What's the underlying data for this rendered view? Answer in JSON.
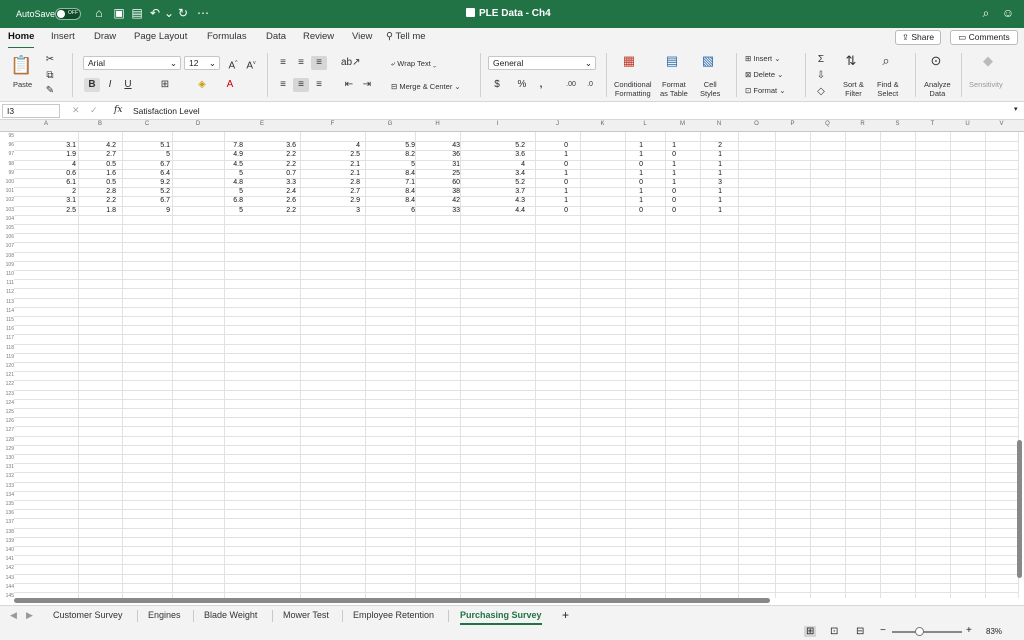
{
  "titlebar": {
    "autosave_label": "AutoSave",
    "autosave_state": "OFF",
    "doc_title": "PLE Data - Ch4"
  },
  "tabs": [
    "Home",
    "Insert",
    "Draw",
    "Page Layout",
    "Formulas",
    "Data",
    "Review",
    "View",
    "Tell me"
  ],
  "share_label": "Share",
  "comments_label": "Comments",
  "ribbon": {
    "paste": "Paste",
    "font_name": "Arial",
    "font_size": "12",
    "wrap_text": "Wrap Text",
    "merge_center": "Merge & Center",
    "number_format": "General",
    "conditional_formatting": [
      "Conditional",
      "Formatting"
    ],
    "format_as_table": [
      "Format",
      "as Table"
    ],
    "cell_styles": [
      "Cell",
      "Styles"
    ],
    "insert": "Insert",
    "delete": "Delete",
    "format": "Format",
    "sort_filter": [
      "Sort &",
      "Filter"
    ],
    "find_select": [
      "Find &",
      "Select"
    ],
    "analyze_data": [
      "Analyze",
      "Data"
    ],
    "sensitivity": "Sensitivity"
  },
  "formula_bar": {
    "name_box": "I3",
    "content": "Satisfaction Level"
  },
  "column_headers": [
    "A",
    "B",
    "C",
    "D",
    "E",
    "F",
    "G",
    "H",
    "I",
    "J",
    "K",
    "L",
    "M",
    "N",
    "O",
    "P",
    "Q",
    "R",
    "S",
    "T",
    "U",
    "V"
  ],
  "row_numbers": [
    "95",
    "96",
    "97",
    "98",
    "99",
    "100",
    "101",
    "102",
    "103",
    "104",
    "105",
    "106",
    "107",
    "108",
    "109",
    "110",
    "111",
    "112",
    "113",
    "114",
    "115",
    "116",
    "117",
    "118",
    "119",
    "120",
    "121",
    "122",
    "123",
    "124",
    "125",
    "126",
    "127",
    "128",
    "129",
    "130",
    "131",
    "132",
    "133",
    "134",
    "135",
    "136",
    "137",
    "138",
    "139",
    "140",
    "141",
    "142",
    "143",
    "144",
    "145"
  ],
  "data_rows": [
    [
      "3.1",
      "4.2",
      "5.1",
      "7.8",
      "3.6",
      "4",
      "5.9",
      "43",
      "5.2",
      "0",
      "1",
      "1",
      "2"
    ],
    [
      "1.9",
      "2.7",
      "5",
      "4.9",
      "2.2",
      "2.5",
      "8.2",
      "36",
      "3.6",
      "1",
      "1",
      "0",
      "1"
    ],
    [
      "4",
      "0.5",
      "6.7",
      "4.5",
      "2.2",
      "2.1",
      "5",
      "31",
      "4",
      "0",
      "0",
      "1",
      "1"
    ],
    [
      "0.6",
      "1.6",
      "6.4",
      "5",
      "0.7",
      "2.1",
      "8.4",
      "25",
      "3.4",
      "1",
      "1",
      "1",
      "1"
    ],
    [
      "6.1",
      "0.5",
      "9.2",
      "4.8",
      "3.3",
      "2.8",
      "7.1",
      "60",
      "5.2",
      "0",
      "0",
      "1",
      "3"
    ],
    [
      "2",
      "2.8",
      "5.2",
      "5",
      "2.4",
      "2.7",
      "8.4",
      "38",
      "3.7",
      "1",
      "1",
      "0",
      "1"
    ],
    [
      "3.1",
      "2.2",
      "6.7",
      "6.8",
      "2.6",
      "2.9",
      "8.4",
      "42",
      "4.3",
      "1",
      "1",
      "0",
      "1"
    ],
    [
      "2.5",
      "1.8",
      "9",
      "5",
      "2.2",
      "3",
      "6",
      "33",
      "4.4",
      "0",
      "0",
      "0",
      "1"
    ]
  ],
  "sheets": [
    "Customer Survey",
    "Engines",
    "Blade Weight",
    "Mower Test",
    "Employee Retention",
    "Purchasing Survey"
  ],
  "active_sheet": "Purchasing Survey",
  "zoom": "83%"
}
